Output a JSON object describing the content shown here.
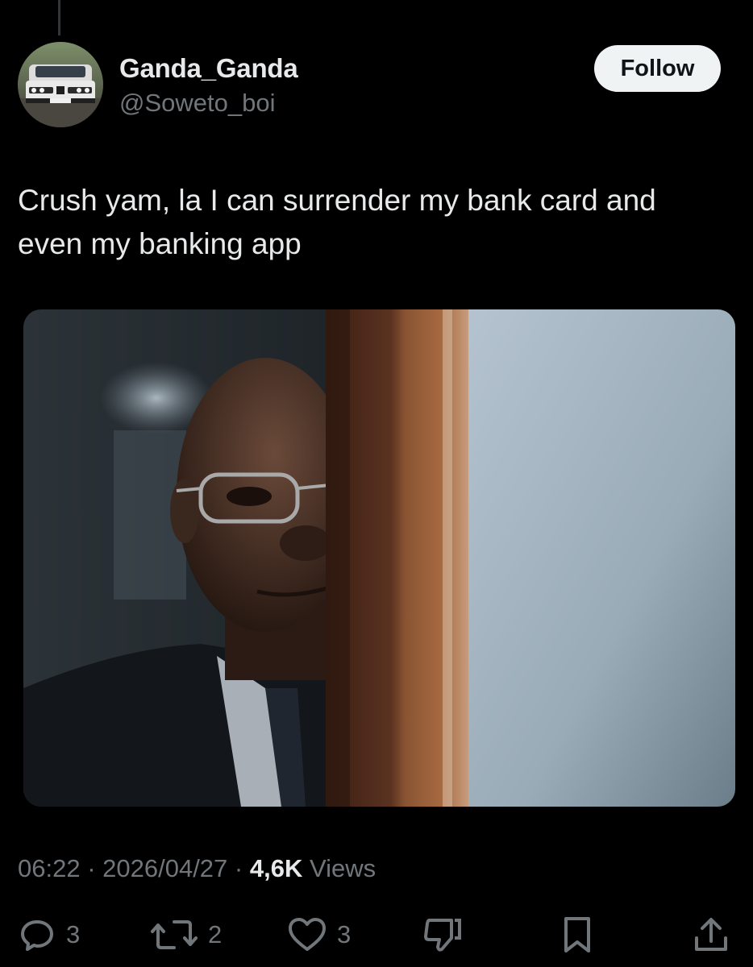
{
  "user": {
    "display_name": "Ganda_Ganda",
    "handle": "@Soweto_boi",
    "avatar_icon": "car-avatar"
  },
  "follow_button": {
    "label": "Follow"
  },
  "tweet": {
    "text": "Crush yam, la I can surrender my bank card and\neven my banking app"
  },
  "media": {
    "icon": "photo-man-peeking-behind-door"
  },
  "meta": {
    "time": "06:22",
    "date": "2026/04/27",
    "separator": " · ",
    "views_count": "4,6K",
    "views_label": " Views"
  },
  "actions": {
    "replies": {
      "icon": "reply-icon",
      "count": "3"
    },
    "reposts": {
      "icon": "repost-icon",
      "count": "2"
    },
    "likes": {
      "icon": "heart-icon",
      "count": "3"
    },
    "dislike": {
      "icon": "dislike-icon"
    },
    "bookmark": {
      "icon": "bookmark-icon"
    },
    "share": {
      "icon": "share-icon"
    }
  },
  "colors": {
    "background": "#000000",
    "primary_text": "#e7e9ea",
    "secondary_text": "#71767b",
    "follow_bg": "#eff3f4"
  }
}
